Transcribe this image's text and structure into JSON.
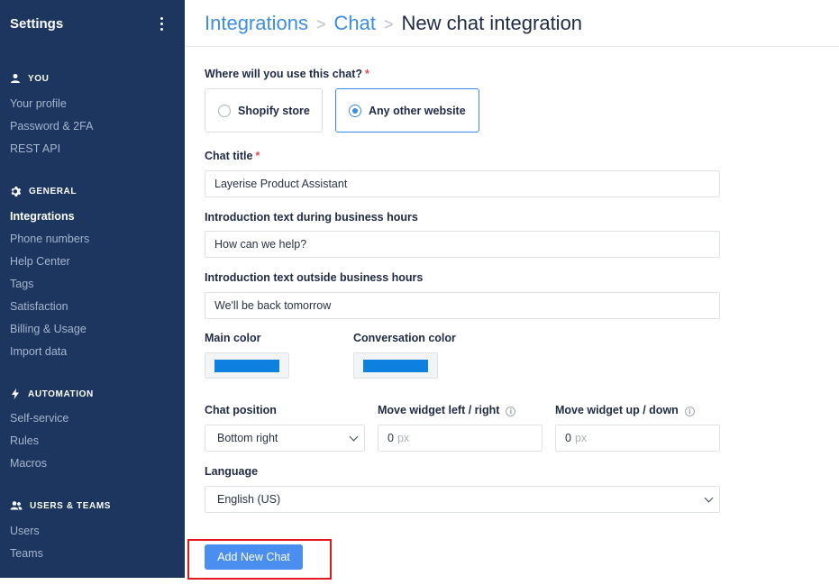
{
  "sidebar": {
    "title": "Settings",
    "menu_icon": "kebab-menu-icon",
    "sections": [
      {
        "label": "YOU",
        "icon": "user-icon",
        "items": [
          "Your profile",
          "Password & 2FA",
          "REST API"
        ]
      },
      {
        "label": "GENERAL",
        "icon": "gear-icon",
        "items": [
          "Integrations",
          "Phone numbers",
          "Help Center",
          "Tags",
          "Satisfaction",
          "Billing & Usage",
          "Import data"
        ]
      },
      {
        "label": "AUTOMATION",
        "icon": "lightning-icon",
        "items": [
          "Self-service",
          "Rules",
          "Macros"
        ]
      },
      {
        "label": "USERS & TEAMS",
        "icon": "users-icon",
        "items": [
          "Users",
          "Teams"
        ]
      }
    ],
    "active_item": "Integrations"
  },
  "breadcrumb": {
    "items": [
      "Integrations",
      "Chat"
    ],
    "separator": ">",
    "current": "New chat integration"
  },
  "form": {
    "usage_question": "Where will you use this chat?",
    "required_mark": "*",
    "usage_options": [
      "Shopify store",
      "Any other website"
    ],
    "usage_selected": "Any other website",
    "chat_title": {
      "label": "Chat title",
      "value": "Layerise Product Assistant"
    },
    "intro_business": {
      "label": "Introduction text during business hours",
      "value": "How can we help?"
    },
    "intro_outside": {
      "label": "Introduction text outside business hours",
      "value": "We'll be back tomorrow"
    },
    "main_color": {
      "label": "Main color",
      "value": "#0d80e0"
    },
    "conversation_color": {
      "label": "Conversation color",
      "value": "#0d80e0"
    },
    "chat_position": {
      "label": "Chat position",
      "value": "Bottom right"
    },
    "move_left_right": {
      "label": "Move widget left / right",
      "value": "0",
      "unit": "px"
    },
    "move_up_down": {
      "label": "Move widget up / down",
      "value": "0",
      "unit": "px"
    },
    "language": {
      "label": "Language",
      "value": "English (US)"
    },
    "info_glyph": "i"
  },
  "actions": {
    "add_new_chat": "Add New Chat"
  },
  "colors": {
    "sidebar_bg": "#1c3660",
    "accent": "#3c8de6",
    "button": "#4a8ff0",
    "highlight": "#e5191d"
  }
}
